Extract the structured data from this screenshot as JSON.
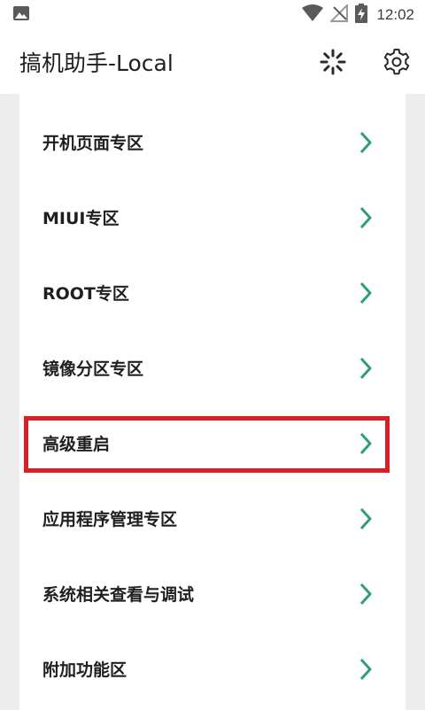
{
  "status_bar": {
    "time": "12:02",
    "icons": [
      "image-notification-icon",
      "wifi-icon",
      "no-signal-icon",
      "battery-charging-icon"
    ]
  },
  "app_bar": {
    "title": "搞机助手-Local",
    "actions": [
      "loading-spinner-icon",
      "gear-icon"
    ]
  },
  "menu": {
    "items": [
      {
        "label": "开机页面专区"
      },
      {
        "label": "MIUI专区"
      },
      {
        "label": "ROOT专区"
      },
      {
        "label": "镜像分区专区"
      },
      {
        "label": "高级重启",
        "highlighted": true
      },
      {
        "label": "应用程序管理专区"
      },
      {
        "label": "系统相关查看与调试"
      },
      {
        "label": "附加功能区"
      }
    ]
  },
  "colors": {
    "chevron": "#2e9e7a",
    "highlight_border": "#d81e26",
    "background": "#ececec",
    "card": "#ffffff"
  }
}
